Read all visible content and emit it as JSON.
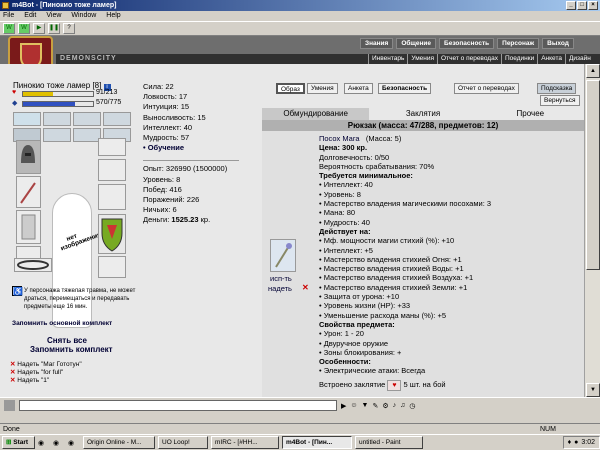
{
  "window": {
    "title": "m4Bot - [Пинокио тоже ламер]"
  },
  "menu": [
    "File",
    "Edit",
    "View",
    "Window",
    "Help"
  ],
  "game": {
    "logo_text": "DEMONSCITY",
    "topnav": [
      "Знания",
      "Общение",
      "Безопасность",
      "Персонаж",
      "Выход"
    ],
    "subnav": [
      "Инвентарь",
      "Умения",
      "Отчет о переводах",
      "Поединки",
      "Анкета",
      "Дизайн"
    ]
  },
  "character": {
    "name": "Пинокио тоже ламер",
    "level": "[8]",
    "hp": "91/213",
    "mp": "570/775",
    "hp_fraction": 0.43,
    "mp_fraction": 0.74,
    "figure_label": "нет изображения"
  },
  "stats": [
    {
      "label": "Сила:",
      "value": "22"
    },
    {
      "label": "Ловкость:",
      "value": "17"
    },
    {
      "label": "Интуиция:",
      "value": "15"
    },
    {
      "label": "Выносливость:",
      "value": "15"
    },
    {
      "label": "Интеллект:",
      "value": "40"
    },
    {
      "label": "Мудрость:",
      "value": "57"
    }
  ],
  "training": "• Обучение",
  "progress": [
    {
      "label": "Опыт:",
      "value": "326990 (1500000)"
    },
    {
      "label": "Уровень:",
      "value": "8"
    },
    {
      "label": "Побед:",
      "value": "416"
    },
    {
      "label": "Поражений:",
      "value": "226"
    },
    {
      "label": "Ничьих:",
      "value": "6"
    },
    {
      "label": "Деньги:",
      "value": "1525.23",
      "suffix": "кр."
    }
  ],
  "injury_text": "У персонажа тяжелая травма, не может драться, перемещаться и передавать предметы еще 16 мин.",
  "remember_set": "Запомнить основной комплект",
  "remove_all": "Снять все",
  "remember_set2": "Запомнить комплект",
  "sets": [
    "Надеть \"Маг Гототун\"",
    "Надеть \"for full\"",
    "Надеть \"1\""
  ],
  "tabs": {
    "obraz": "Образ",
    "umeniya": "Умения",
    "anketa": "Анкета",
    "security": "Безопасность",
    "transfers": "Отчет о переводах",
    "hint": "Подсказка",
    "back": "Вернуться"
  },
  "inv_tabs": [
    "Обмундирование",
    "Заклятия",
    "Прочее"
  ],
  "backpack": "Рюкзак (масса: 47/288, предметов: 12)",
  "item": {
    "name": "Посох Мага",
    "mass": "(Масса: 5)",
    "price": "Цена: 300 кр.",
    "durability": "Долговечность: 0/50",
    "chance": "Вероятность срабатывания: 70%",
    "req_title": "Требуется минимальное:",
    "requirements": [
      "• Интеллект: 40",
      "• Уровень: 8",
      "• Мастерство владения магическими посохами: 3",
      "• Мана: 80",
      "• Мудрость: 40"
    ],
    "acts_title": "Действует на:",
    "acts": [
      "• Мф. мощности магии стихий (%): +10",
      "• Интеллект: +5",
      "• Мастерство владения стихией Огня: +1",
      "• Мастерство владения стихией Воды: +1",
      "• Мастерство владения стихией Воздуха: +1",
      "• Мастерство владения стихией Земли: +1",
      "• Защита от урона: +10",
      "• Уровень жизни (HP): +33",
      "• Уменьшение расхода маны (%): +5"
    ],
    "props_title": "Свойства предмета:",
    "props": [
      "• Урон: 1 - 20",
      "• Двуручное оружие",
      "• Зоны блокирования: +"
    ],
    "feat_title": "Особенности:",
    "features": [
      "• Электрические атаки: Всегда"
    ],
    "spell": "Встроено заклятие",
    "spell_count": "5 шт. на бой",
    "use": "исп-ть",
    "wear": "надеть"
  },
  "status": {
    "text": "Done",
    "num": "NUM"
  },
  "taskbar": {
    "start": "Start",
    "tasks": [
      "Origin Online - M...",
      "UO Loop!",
      "mIRC - [#HH...",
      "m4Bot - [Пин...",
      "untitled - Paint"
    ],
    "clock": "3:02"
  }
}
